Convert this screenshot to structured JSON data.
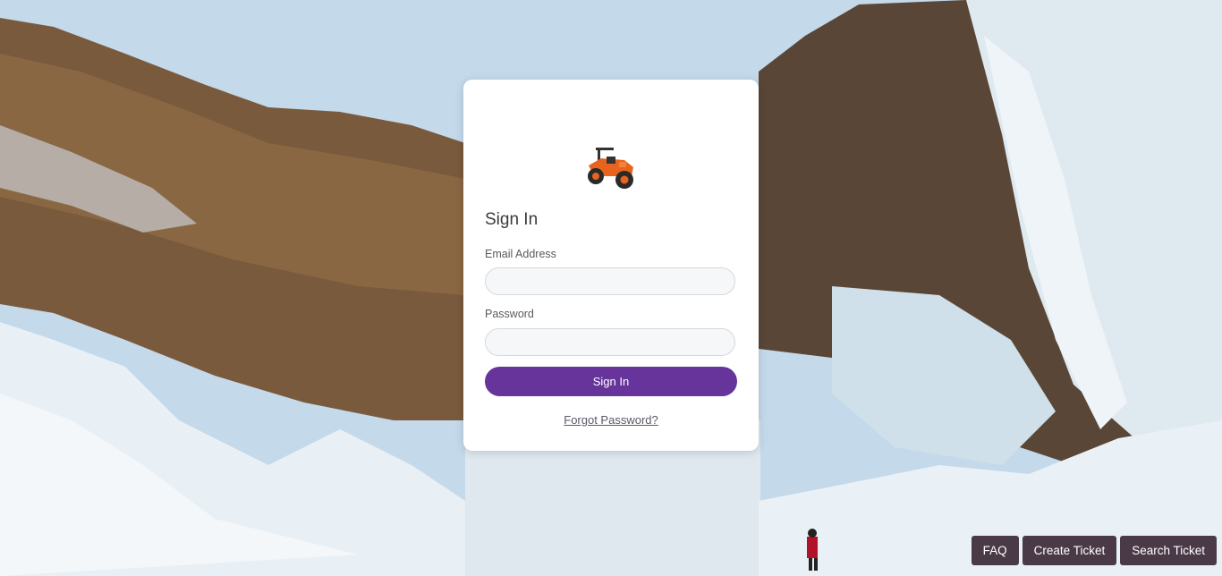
{
  "login": {
    "logo": "tractor-icon",
    "title": "Sign In",
    "email_label": "Email Address",
    "email_value": "",
    "password_label": "Password",
    "password_value": "",
    "submit_label": "Sign In",
    "forgot_label": "Forgot Password?"
  },
  "footer_buttons": {
    "faq": "FAQ",
    "create_ticket": "Create Ticket",
    "search_ticket": "Search Ticket"
  },
  "colors": {
    "primary": "#66349a",
    "footer_button": "#4a3a48"
  }
}
